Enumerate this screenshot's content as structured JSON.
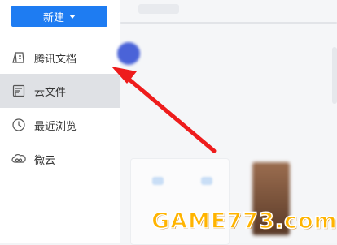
{
  "sidebar": {
    "new_button_label": "新建",
    "items": [
      {
        "label": "腾讯文档",
        "icon": "tencent-docs-icon"
      },
      {
        "label": "云文件",
        "icon": "cloud-file-icon",
        "active": true
      },
      {
        "label": "最近浏览",
        "icon": "clock-icon"
      },
      {
        "label": "微云",
        "icon": "weiyun-cloud-icon"
      }
    ]
  },
  "watermark": "GAME773.com",
  "colors": {
    "accent": "#1e7cf2",
    "arrow": "#ee1c1c",
    "active_bg": "#dfe1e5"
  }
}
